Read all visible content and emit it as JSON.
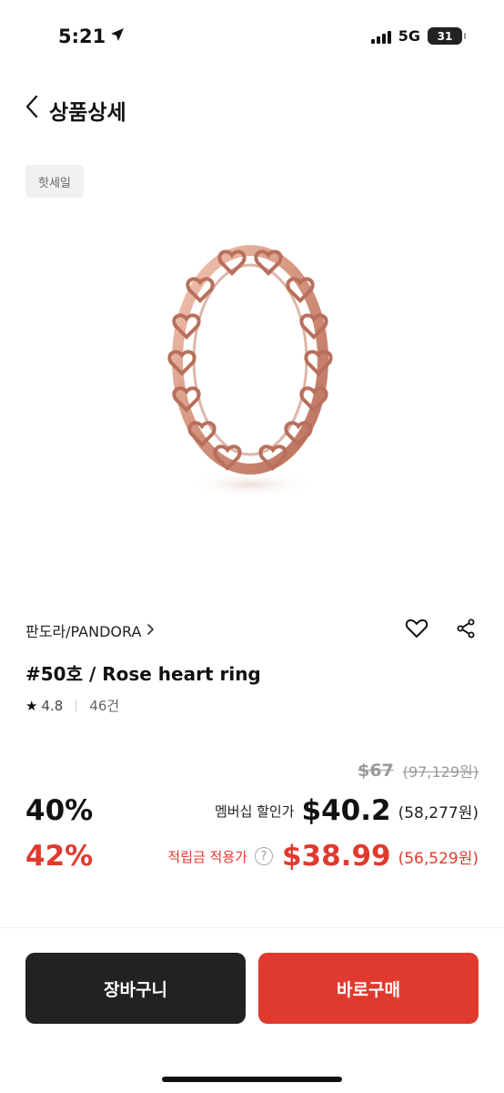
{
  "status_bar": {
    "time": "5:21",
    "network": "5G",
    "battery": "31"
  },
  "header": {
    "title": "상품상세"
  },
  "badge": "핫세일",
  "product": {
    "brand": "판도라/PANDORA",
    "name": "#50호 / Rose heart ring",
    "rating": "4.8",
    "review_count": "46건"
  },
  "pricing": {
    "original_price": "$67",
    "original_price_krw": "(97,129원)",
    "member": {
      "discount": "40%",
      "label": "멤버십 할인가",
      "price": "$40.2",
      "price_krw": "(58,277원)"
    },
    "points": {
      "discount": "42%",
      "label": "적립금 적용가",
      "help": "?",
      "price": "$38.99",
      "price_krw": "(56,529원)"
    }
  },
  "actions": {
    "cart_label": "장바구니",
    "buy_label": "바로구매"
  },
  "colors": {
    "accent_red": "#e03a2e",
    "dark_button": "#222222",
    "ring_rose_gold": "#d99a84"
  },
  "icons": [
    "navigation-arrow-icon",
    "signal-icon",
    "battery-icon",
    "back-chevron-icon",
    "chevron-right-icon",
    "heart-icon",
    "share-icon",
    "star-icon",
    "help-icon"
  ]
}
